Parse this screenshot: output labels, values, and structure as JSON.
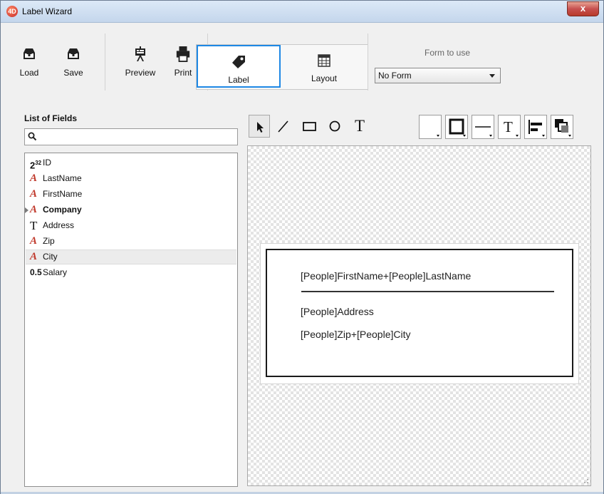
{
  "window": {
    "app_icon": "4D",
    "title": "Label Wizard",
    "close_label": "x"
  },
  "toolbar": {
    "load_label": "Load",
    "save_label": "Save",
    "preview_label": "Preview",
    "print_label": "Print",
    "label_mode_label": "Label",
    "layout_mode_label": "Layout",
    "active_mode": "Label",
    "form_to_use_label": "Form to use",
    "form_select_value": "No Form"
  },
  "fields_panel": {
    "title": "List of Fields",
    "search_placeholder": "",
    "fields": [
      {
        "icon": "2³²",
        "name": "ID",
        "type": "integer"
      },
      {
        "icon": "A",
        "name": "LastName",
        "type": "alpha"
      },
      {
        "icon": "A",
        "name": "FirstName",
        "type": "alpha"
      },
      {
        "icon": "A",
        "name": "Company",
        "type": "alpha",
        "bold": true,
        "expandable": true
      },
      {
        "icon": "T",
        "name": "Address",
        "type": "text"
      },
      {
        "icon": "A",
        "name": "Zip",
        "type": "alpha"
      },
      {
        "icon": "A",
        "name": "City",
        "type": "alpha",
        "selected": true
      },
      {
        "icon": "0.5",
        "name": "Salary",
        "type": "real"
      }
    ]
  },
  "drawing_tools": {
    "items": [
      "arrow-tool",
      "line-tool",
      "rectangle-tool",
      "oval-tool",
      "text-tool"
    ],
    "text_tool_glyph": "T",
    "format_buttons": [
      "fill-color",
      "border-color",
      "line-style",
      "text-style",
      "alignment",
      "arrange"
    ],
    "text_style_glyph": "T"
  },
  "label_preview": {
    "line1": "[People]FirstName+[People]LastName",
    "line2": "[People]Address",
    "line3": "[People]Zip+[People]City"
  },
  "colors": {
    "accent": "#1e88e5",
    "title_bar": "#c4d6ec",
    "close_button": "#c75050",
    "alpha_icon": "#c0392b"
  }
}
